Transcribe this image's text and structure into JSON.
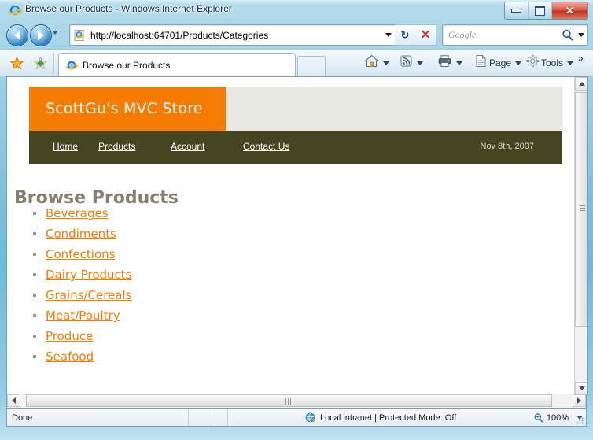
{
  "window": {
    "title": "Browse our Products - Windows Internet Explorer",
    "icon": "internet-explorer-icon",
    "buttons": {
      "minimize": "Minimize",
      "maximize": "Maximize",
      "close": "Close"
    }
  },
  "navigation": {
    "back_label": "Back",
    "forward_label": "Forward",
    "history_dropdown_label": "Recent Pages",
    "address": {
      "value": "http://localhost:64701/Products/Categories",
      "placeholder": "",
      "icon": "page-icon",
      "dropdown": "address-dropdown-caret"
    },
    "refresh_label": "↻",
    "stop_label": "✕",
    "search": {
      "value": "",
      "placeholder": "Google",
      "icon": "magnifier-icon",
      "dropdown": "search-dropdown-caret"
    }
  },
  "command_bar": {
    "favorites_center_icon": "star-icon",
    "add_favorite_icon": "star-plus-icon",
    "tab": {
      "label": "Browse our Products",
      "icon": "internet-explorer-icon"
    },
    "new_tab_label": "",
    "items": [
      {
        "label": "",
        "icon": "home-icon",
        "name": "home"
      },
      {
        "label": "",
        "icon": "feeds-icon",
        "name": "feeds"
      },
      {
        "label": "",
        "icon": "print-icon",
        "name": "print"
      },
      {
        "label": "Page",
        "icon": "page-icon",
        "name": "page"
      },
      {
        "label": "Tools",
        "icon": "gear-icon",
        "name": "tools"
      }
    ],
    "overflow_label": "»"
  },
  "site": {
    "logo_text": "ScottGu's MVC Store",
    "date": "Nov 8th, 2007",
    "nav": [
      {
        "label": "Home"
      },
      {
        "label": "Products"
      },
      {
        "label": "Account"
      },
      {
        "label": "Contact Us"
      }
    ],
    "page_title": "Browse Products",
    "categories": [
      {
        "label": "Beverages"
      },
      {
        "label": "Condiments"
      },
      {
        "label": "Confections"
      },
      {
        "label": "Dairy Products"
      },
      {
        "label": "Grains/Cereals"
      },
      {
        "label": "Meat/Poultry"
      },
      {
        "label": "Produce"
      },
      {
        "label": "Seafood"
      }
    ]
  },
  "status_bar": {
    "text": "Done",
    "zone_icon": "local-intranet-icon",
    "zone_text": "Local intranet | Protected Mode: Off",
    "zoom_icon": "zoom-icon",
    "zoom_level": "100%"
  },
  "colors": {
    "brand_orange": "#f57c00",
    "nav_olive": "#454521",
    "banner_grey": "#e9e9e3",
    "heading_grey": "#847f6f",
    "link_orange": "#f57c00"
  }
}
